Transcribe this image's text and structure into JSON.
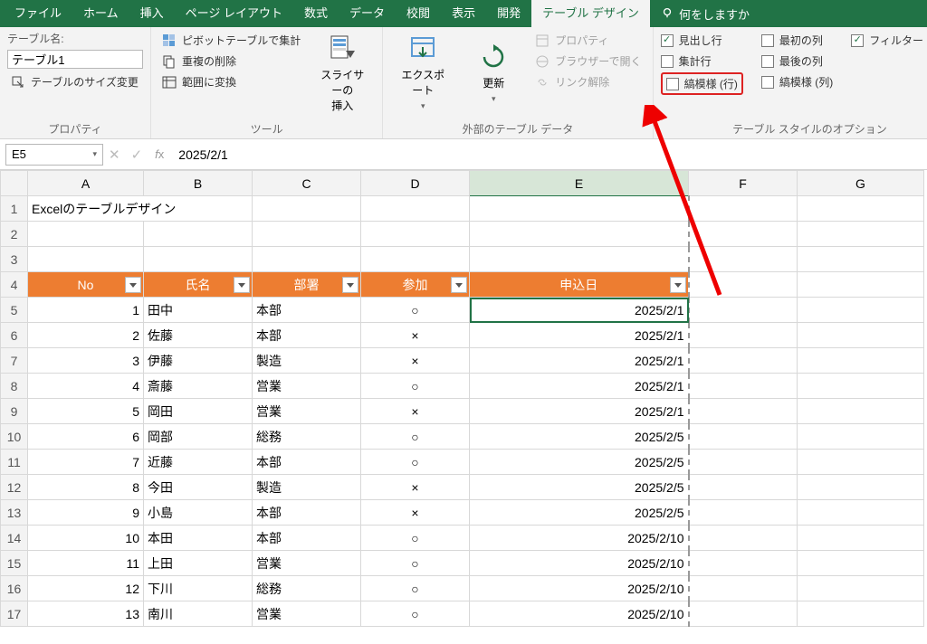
{
  "tabs": [
    "ファイル",
    "ホーム",
    "挿入",
    "ページ レイアウト",
    "数式",
    "データ",
    "校閲",
    "表示",
    "開発",
    "テーブル デザイン"
  ],
  "tellme": "何をしますか",
  "ribbon": {
    "group1": {
      "nameLabel": "テーブル名:",
      "nameValue": "テーブル1",
      "resize": "テーブルのサイズ変更",
      "label": "プロパティ"
    },
    "group2": {
      "pivot": "ピボットテーブルで集計",
      "dedup": "重複の削除",
      "convert": "範囲に変換",
      "slicerTop": "スライサーの",
      "slicerBot": "挿入",
      "label": "ツール"
    },
    "group3": {
      "exportTop": "エクスポート",
      "refreshTop": "更新",
      "properties": "プロパティ",
      "browser": "ブラウザーで開く",
      "unlink": "リンク解除",
      "label": "外部のテーブル データ"
    },
    "group4": {
      "headerRow": "見出し行",
      "totalRow": "集計行",
      "bandedRows": "縞模様 (行)",
      "firstCol": "最初の列",
      "lastCol": "最後の列",
      "bandedCols": "縞模様 (列)",
      "filterBtn": "フィルター ボタン",
      "label": "テーブル スタイルのオプション"
    }
  },
  "formula": {
    "cellRef": "E5",
    "value": "2025/2/1"
  },
  "cols": [
    "A",
    "B",
    "C",
    "D",
    "E",
    "F",
    "G"
  ],
  "row1": "Excelのテーブルデザイン",
  "headers": [
    "No",
    "氏名",
    "部署",
    "参加",
    "申込日"
  ],
  "rows": [
    {
      "r": 5,
      "no": 1,
      "name": "田中",
      "dept": "本部",
      "att": "○",
      "date": "2025/2/1"
    },
    {
      "r": 6,
      "no": 2,
      "name": "佐藤",
      "dept": "本部",
      "att": "×",
      "date": "2025/2/1"
    },
    {
      "r": 7,
      "no": 3,
      "name": "伊藤",
      "dept": "製造",
      "att": "×",
      "date": "2025/2/1"
    },
    {
      "r": 8,
      "no": 4,
      "name": "斎藤",
      "dept": "営業",
      "att": "○",
      "date": "2025/2/1"
    },
    {
      "r": 9,
      "no": 5,
      "name": "岡田",
      "dept": "営業",
      "att": "×",
      "date": "2025/2/1"
    },
    {
      "r": 10,
      "no": 6,
      "name": "岡部",
      "dept": "総務",
      "att": "○",
      "date": "2025/2/5"
    },
    {
      "r": 11,
      "no": 7,
      "name": "近藤",
      "dept": "本部",
      "att": "○",
      "date": "2025/2/5"
    },
    {
      "r": 12,
      "no": 8,
      "name": "今田",
      "dept": "製造",
      "att": "×",
      "date": "2025/2/5"
    },
    {
      "r": 13,
      "no": 9,
      "name": "小島",
      "dept": "本部",
      "att": "×",
      "date": "2025/2/5"
    },
    {
      "r": 14,
      "no": 10,
      "name": "本田",
      "dept": "本部",
      "att": "○",
      "date": "2025/2/10"
    },
    {
      "r": 15,
      "no": 11,
      "name": "上田",
      "dept": "営業",
      "att": "○",
      "date": "2025/2/10"
    },
    {
      "r": 16,
      "no": 12,
      "name": "下川",
      "dept": "総務",
      "att": "○",
      "date": "2025/2/10"
    },
    {
      "r": 17,
      "no": 13,
      "name": "南川",
      "dept": "営業",
      "att": "○",
      "date": "2025/2/10"
    }
  ]
}
